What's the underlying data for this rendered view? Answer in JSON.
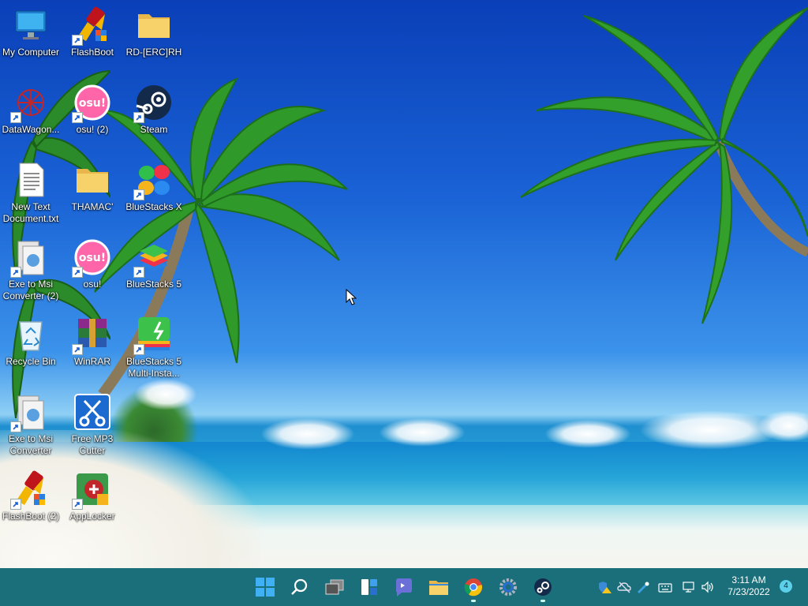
{
  "desktop": {
    "icons": [
      {
        "label": "My Computer",
        "icon": "monitor-icon"
      },
      {
        "label": "FlashBoot",
        "icon": "flashboot-icon"
      },
      {
        "label": "RD-[ERC]RH",
        "icon": "folder-icon"
      },
      {
        "label": "DataWagon...",
        "icon": "datawagon-icon"
      },
      {
        "label": "osu! (2)",
        "icon": "osu-icon"
      },
      {
        "label": "Steam",
        "icon": "steam-icon"
      },
      {
        "label": "New Text Document.txt",
        "icon": "text-document-icon"
      },
      {
        "label": "THAMAC'",
        "icon": "folder-icon"
      },
      {
        "label": "BlueStacks X",
        "icon": "bluestacks-x-icon"
      },
      {
        "label": "Exe to Msi Converter (2)",
        "icon": "exe-to-msi-icon"
      },
      {
        "label": "osu!",
        "icon": "osu-icon"
      },
      {
        "label": "BlueStacks 5",
        "icon": "bluestacks-5-icon"
      },
      {
        "label": "Recycle Bin",
        "icon": "recycle-bin-icon"
      },
      {
        "label": "WinRAR",
        "icon": "winrar-icon"
      },
      {
        "label": "BlueStacks 5 Multi-Insta...",
        "icon": "bluestacks-multi-instance-icon"
      },
      {
        "label": "Exe to Msi Converter",
        "icon": "exe-to-msi-icon"
      },
      {
        "label": "Free MP3 Cutter",
        "icon": "scissors-icon"
      },
      {
        "label": "FlashBoot (2)",
        "icon": "flashboot-icon"
      },
      {
        "label": "AppLocker",
        "icon": "applocker-icon"
      }
    ]
  },
  "taskbar": {
    "apps": [
      {
        "name": "start-button",
        "icon": "windows-logo-icon"
      },
      {
        "name": "search-button",
        "icon": "search-icon"
      },
      {
        "name": "task-view-button",
        "icon": "task-view-icon"
      },
      {
        "name": "widgets-button",
        "icon": "widgets-icon"
      },
      {
        "name": "teams-chat-button",
        "icon": "chat-icon"
      },
      {
        "name": "file-explorer-button",
        "icon": "folder-icon"
      },
      {
        "name": "chrome-button",
        "icon": "chrome-icon"
      },
      {
        "name": "settings-button",
        "icon": "gear-icon"
      },
      {
        "name": "steam-button",
        "icon": "steam-icon"
      }
    ],
    "tray": {
      "time": "3:11 AM",
      "date": "7/23/2022",
      "notification_count": "4",
      "icons": [
        "defender-warning-icon",
        "onedrive-icon",
        "pen-icon",
        "keyboard-icon",
        "network-icon",
        "volume-icon"
      ]
    }
  },
  "colors": {
    "taskbar": "#1a6f7a",
    "sky_top": "#0a3fb8",
    "sea": "#1386cf"
  }
}
